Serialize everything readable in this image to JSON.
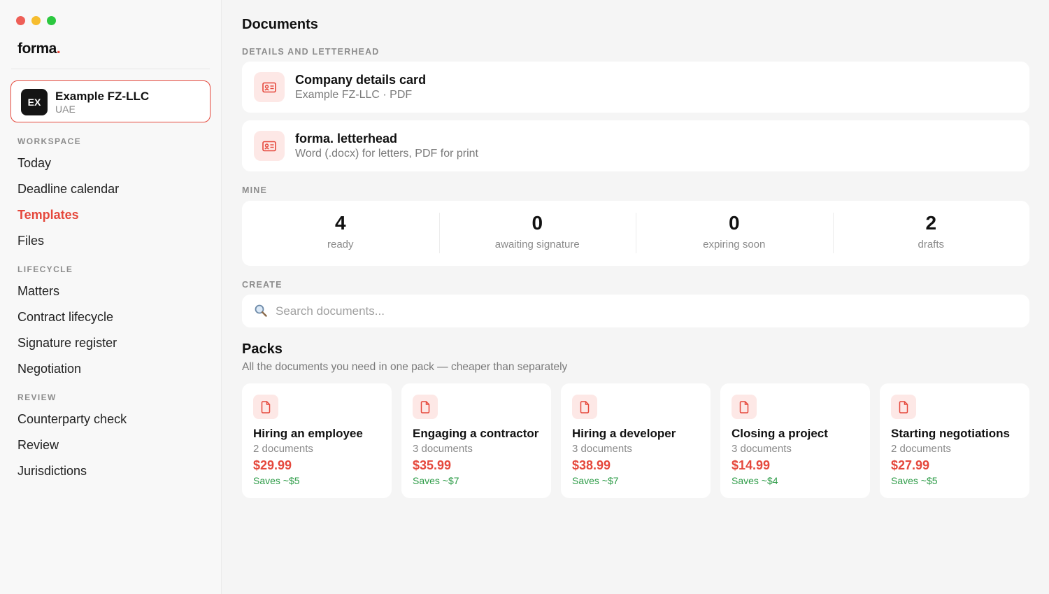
{
  "window": {
    "traffic_lights": {
      "close": "#ee5f57",
      "minimize": "#f6bd2f",
      "zoom": "#2cc840"
    }
  },
  "colors": {
    "accent": "#e5483c",
    "savings": "#2e9c48"
  },
  "sidebar": {
    "logo": "forma",
    "logo_dot": ".",
    "company": {
      "initials": "EX",
      "name": "Example FZ-LLC",
      "country": "UAE"
    },
    "sections": [
      {
        "label": "WORKSPACE",
        "items": [
          "Today",
          "Deadline calendar",
          "Templates",
          "Files"
        ]
      },
      {
        "label": "LIFECYCLE",
        "items": [
          "Matters",
          "Contract lifecycle",
          "Signature register",
          "Negotiation"
        ]
      },
      {
        "label": "REVIEW",
        "items": [
          "Counterparty check",
          "Review",
          "Jurisdictions"
        ]
      }
    ],
    "active_item": "Templates"
  },
  "main": {
    "title": "Documents",
    "details_label": "DETAILS AND LETTERHEAD",
    "docs": [
      {
        "title": "Company details card",
        "subtitle": "Example FZ-LLC · PDF",
        "icon": "id-card-icon"
      },
      {
        "title": "forma. letterhead",
        "subtitle": "Word (.docx) for letters, PDF for print",
        "icon": "id-card-icon"
      }
    ],
    "mine_label": "MINE",
    "stats": [
      {
        "value": "4",
        "label": "ready"
      },
      {
        "value": "0",
        "label": "awaiting signature"
      },
      {
        "value": "0",
        "label": "expiring soon"
      },
      {
        "value": "2",
        "label": "drafts"
      }
    ],
    "create_label": "CREATE",
    "search": {
      "placeholder": "Search documents...",
      "value": "",
      "icon": "search-icon"
    },
    "packs_title": "Packs",
    "packs_subtitle": "All the documents you need in one pack — cheaper than separately",
    "packs": [
      {
        "name": "Hiring an employee",
        "count": "2 documents",
        "price": "$29.99",
        "saves": "Saves ~$5"
      },
      {
        "name": "Engaging a contractor",
        "count": "3 documents",
        "price": "$35.99",
        "saves": "Saves ~$7"
      },
      {
        "name": "Hiring a developer",
        "count": "3 documents",
        "price": "$38.99",
        "saves": "Saves ~$7"
      },
      {
        "name": "Closing a project",
        "count": "3 documents",
        "price": "$14.99",
        "saves": "Saves ~$4"
      },
      {
        "name": "Starting negotiations",
        "count": "2 documents",
        "price": "$27.99",
        "saves": "Saves ~$5"
      }
    ]
  }
}
